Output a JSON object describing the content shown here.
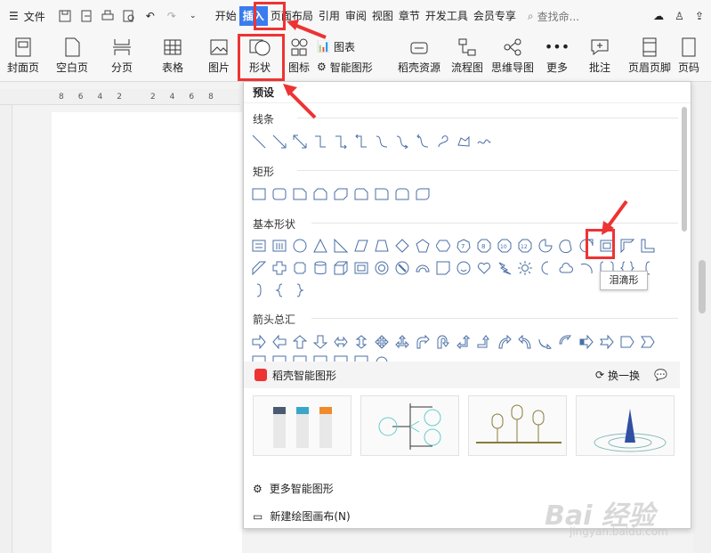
{
  "menu": {
    "file_label": "文件"
  },
  "tabs": [
    {
      "label": "开始",
      "active": false
    },
    {
      "label": "插入",
      "active": true
    },
    {
      "label": "页面布局",
      "active": false
    },
    {
      "label": "引用",
      "active": false
    },
    {
      "label": "审阅",
      "active": false
    },
    {
      "label": "视图",
      "active": false
    },
    {
      "label": "章节",
      "active": false
    },
    {
      "label": "开发工具",
      "active": false
    },
    {
      "label": "会员专享",
      "active": false
    }
  ],
  "search": {
    "placeholder": "查找命..."
  },
  "ribbon": {
    "cover": "封面页",
    "blank": "空白页",
    "pagebreak": "分页",
    "table": "表格",
    "picture": "图片",
    "shapes": "形状",
    "icon": "图标",
    "chart": "图表",
    "smart_graphic": "智能图形",
    "docer": "稻壳资源",
    "flowchart": "流程图",
    "mindmap": "思维导图",
    "more": "更多",
    "comment": "批注",
    "header_footer": "页眉页脚",
    "pagenum": "页码"
  },
  "ruler": {
    "ticks": [
      "8",
      "6",
      "4",
      "2",
      "",
      "2",
      "4",
      "6",
      "8"
    ]
  },
  "panel": {
    "title": "预设",
    "sections": {
      "lines": "线条",
      "rect": "矩形",
      "basic": "基本形状",
      "arrows": "箭头总汇"
    },
    "tooltip": "泪滴形",
    "smart_title": "稻壳智能图形",
    "refresh": "换一换",
    "more_smart": "更多智能图形",
    "new_canvas": "新建绘图画布(N)"
  },
  "watermark": {
    "text": "Bai 经验",
    "sub": "jingyan.baidu.com"
  },
  "colors": {
    "accent": "#3a7cf0",
    "highlight": "#e33333",
    "shape_stroke": "#4a6fa5"
  }
}
